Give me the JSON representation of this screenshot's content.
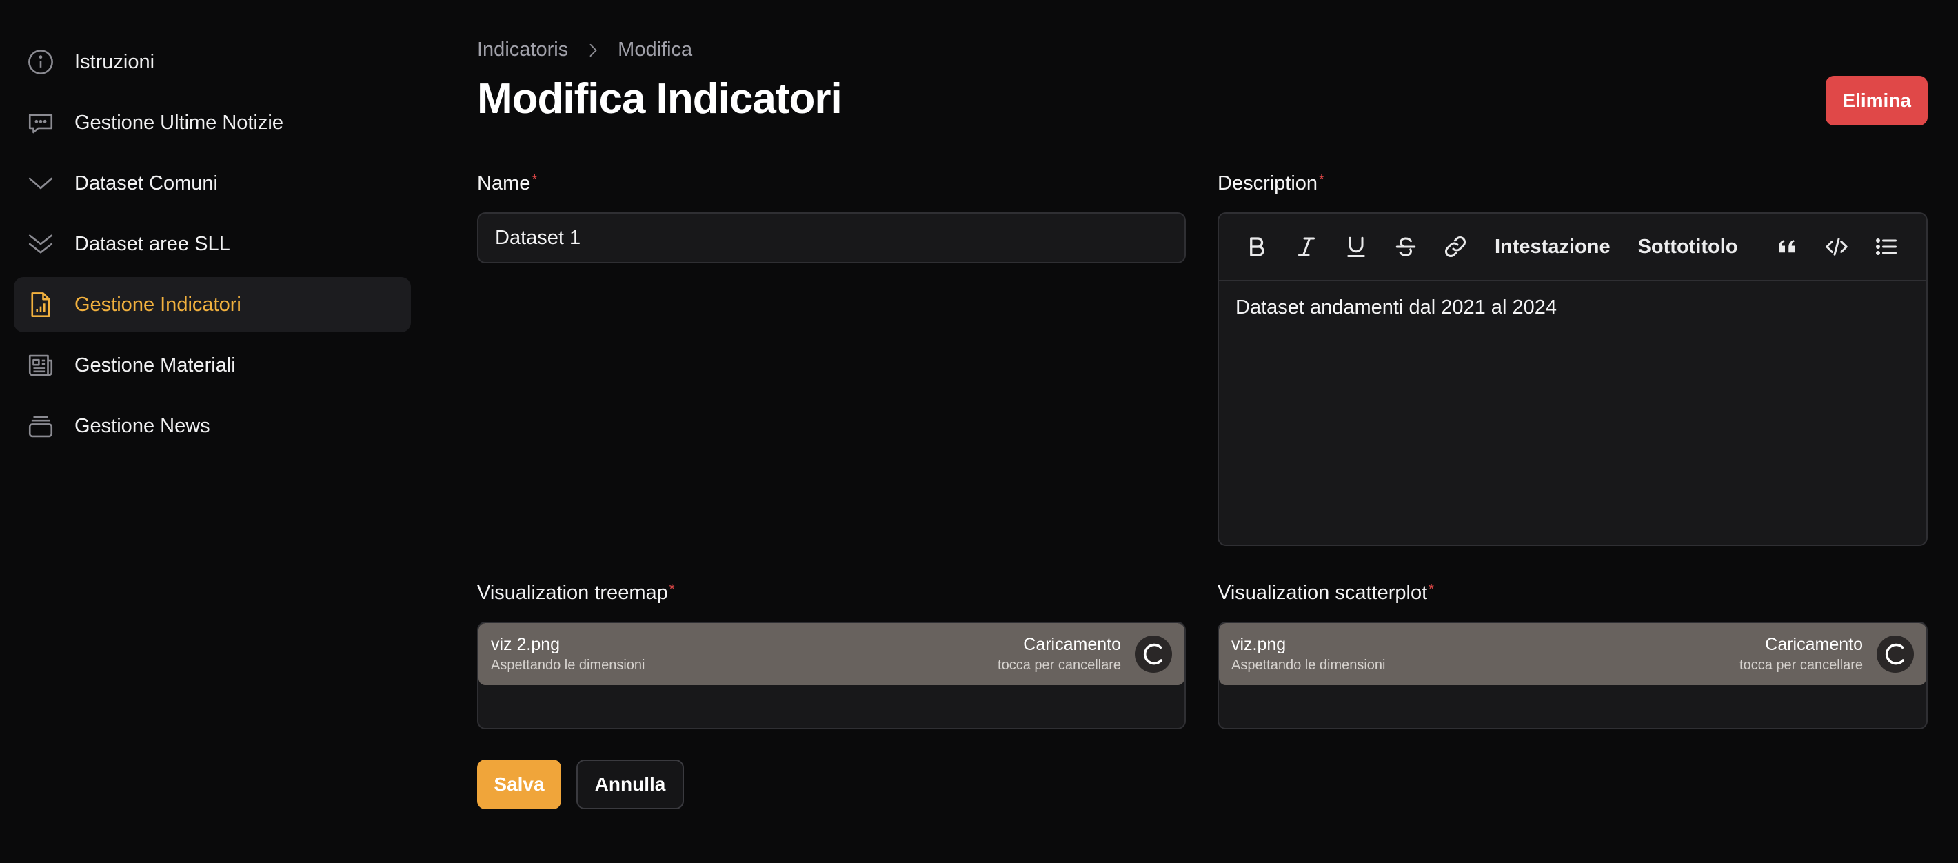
{
  "sidebar": {
    "items": [
      {
        "label": "Istruzioni",
        "icon": "info-circle-icon",
        "active": false
      },
      {
        "label": "Gestione Ultime Notizie",
        "icon": "chat-bubble-icon",
        "active": false
      },
      {
        "label": "Dataset Comuni",
        "icon": "chevron-down-icon",
        "active": false
      },
      {
        "label": "Dataset aree SLL",
        "icon": "double-chevron-down-icon",
        "active": false
      },
      {
        "label": "Gestione Indicatori",
        "icon": "document-chart-icon",
        "active": true
      },
      {
        "label": "Gestione Materiali",
        "icon": "newspaper-icon",
        "active": false
      },
      {
        "label": "Gestione News",
        "icon": "stack-icon",
        "active": false
      }
    ]
  },
  "breadcrumb": {
    "parent": "Indicatoris",
    "current": "Modifica"
  },
  "page": {
    "title": "Modifica Indicatori",
    "delete_label": "Elimina"
  },
  "form": {
    "name": {
      "label": "Name",
      "value": "Dataset 1"
    },
    "description": {
      "label": "Description",
      "toolbar": {
        "heading": "Intestazione",
        "subheading": "Sottotitolo"
      },
      "content": "Dataset andamenti dal 2021 al 2024"
    },
    "treemap": {
      "label": "Visualization treemap",
      "file_name": "viz 2.png",
      "file_status": "Aspettando le dimensioni",
      "upload_status": "Caricamento",
      "upload_hint": "tocca per cancellare"
    },
    "scatterplot": {
      "label": "Visualization scatterplot",
      "file_name": "viz.png",
      "file_status": "Aspettando le dimensioni",
      "upload_status": "Caricamento",
      "upload_hint": "tocca per cancellare"
    },
    "save_label": "Salva",
    "cancel_label": "Annulla",
    "required_marker": "*"
  },
  "colors": {
    "accent": "#f2b13e",
    "danger": "#e04848",
    "save": "#f0a53a",
    "background": "#0a0a0b"
  }
}
